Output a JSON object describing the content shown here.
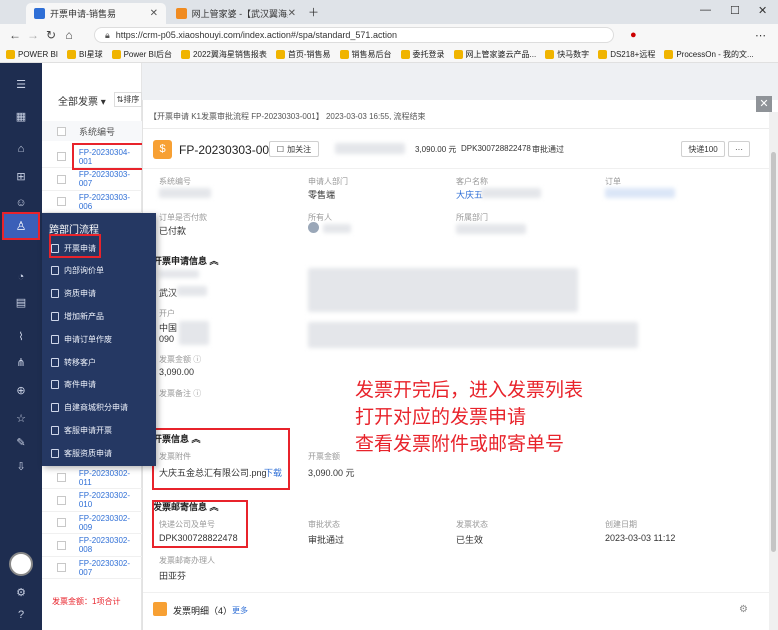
{
  "browser": {
    "tabs": [
      {
        "label": "开票申请-销售易"
      },
      {
        "label": "网上管家婆 -【武汉翼海星科技..."
      }
    ],
    "url": "https://crm-p05.xiaoshouyi.com/index.action#/spa/standard_571.action",
    "bookmarks": [
      "POWER BI",
      "BI星球",
      "Power BI后台",
      "2022翼海星销售报表",
      "首页-销售易",
      "销售易后台",
      "委托登录",
      "网上管家婆云产品...",
      "快马数字",
      "DS218+远程",
      "ProcessOn - 我的文..."
    ]
  },
  "list": {
    "filter_label": "全部发票",
    "sort_label": "排序",
    "column_header": "系统编号",
    "rows_top": [
      "FP-20230304-001",
      "FP-20230303-007",
      "FP-20230303-006"
    ],
    "rows_bottom": [
      "FP-20230302-011",
      "FP-20230302-010",
      "FP-20230302-009",
      "FP-20230302-008",
      "FP-20230302-007"
    ],
    "footer": "发票金额：1项合计"
  },
  "flyout": {
    "title": "跨部门流程",
    "items": [
      "开票申请",
      "内部询价单",
      "资质申请",
      "增加新产品",
      "申请订单作废",
      "转移客户",
      "寄件申请",
      "自建商城积分申请",
      "客服申请开票",
      "客服资质申请"
    ]
  },
  "detail": {
    "breadcrumb": "【开票申请 K1发票审批流程 FP-20230303-001】 2023-03-03 16:55, 流程结束",
    "record_id": "FP-20230303-001",
    "follow_label": "加关注",
    "header_amount": "3,090.00 元",
    "header_tracking": "DPK300728822478",
    "header_status": "审批通过",
    "quick_label": "快递100",
    "more_label": "···",
    "fields_row1": [
      {
        "label": "系统编号",
        "value": ""
      },
      {
        "label": "申请人部门",
        "value": "零售端"
      },
      {
        "label": "客户名称",
        "value": "大庆五"
      },
      {
        "label": "订单",
        "value": ""
      }
    ],
    "fields_row2": [
      {
        "label": "订单是否付款",
        "value": "已付款"
      },
      {
        "label": "所有人",
        "value": ""
      },
      {
        "label": "所属部门",
        "value": ""
      }
    ],
    "section_apply": "开票申请信息",
    "apply_value_1": "武汉",
    "apply_label_2": "开户",
    "apply_value_2a": "中国",
    "apply_value_2b": "090",
    "amount_label": "发票金额",
    "amount_value": "3,090.00",
    "remark_label": "发票备注",
    "section_invoice": "开票信息",
    "attach_label": "发票附件",
    "attach_file": "大庆五金总汇有限公司.png",
    "download_label": "下载",
    "invoice_amount_label": "开票金额",
    "invoice_amount_value": "3,090.00 元",
    "section_mail": "发票邮寄信息",
    "mail_fields": [
      {
        "label": "快递公司及单号",
        "value": "DPK300728822478"
      },
      {
        "label": "审批状态",
        "value": "审批通过"
      },
      {
        "label": "发票状态",
        "value": "已生效"
      },
      {
        "label": "创建日期",
        "value": "2023-03-03 11:12"
      }
    ],
    "mail_operator_label": "发票邮寄办理人",
    "mail_operator_value": "田亚芬",
    "detail_section": "发票明细",
    "detail_count": "（4）",
    "more_link": "更多"
  },
  "annotation": {
    "line1": "发票开完后，进入发票列表",
    "line2": "打开对应的发票申请",
    "line3": "查看发票附件或邮寄单号"
  }
}
